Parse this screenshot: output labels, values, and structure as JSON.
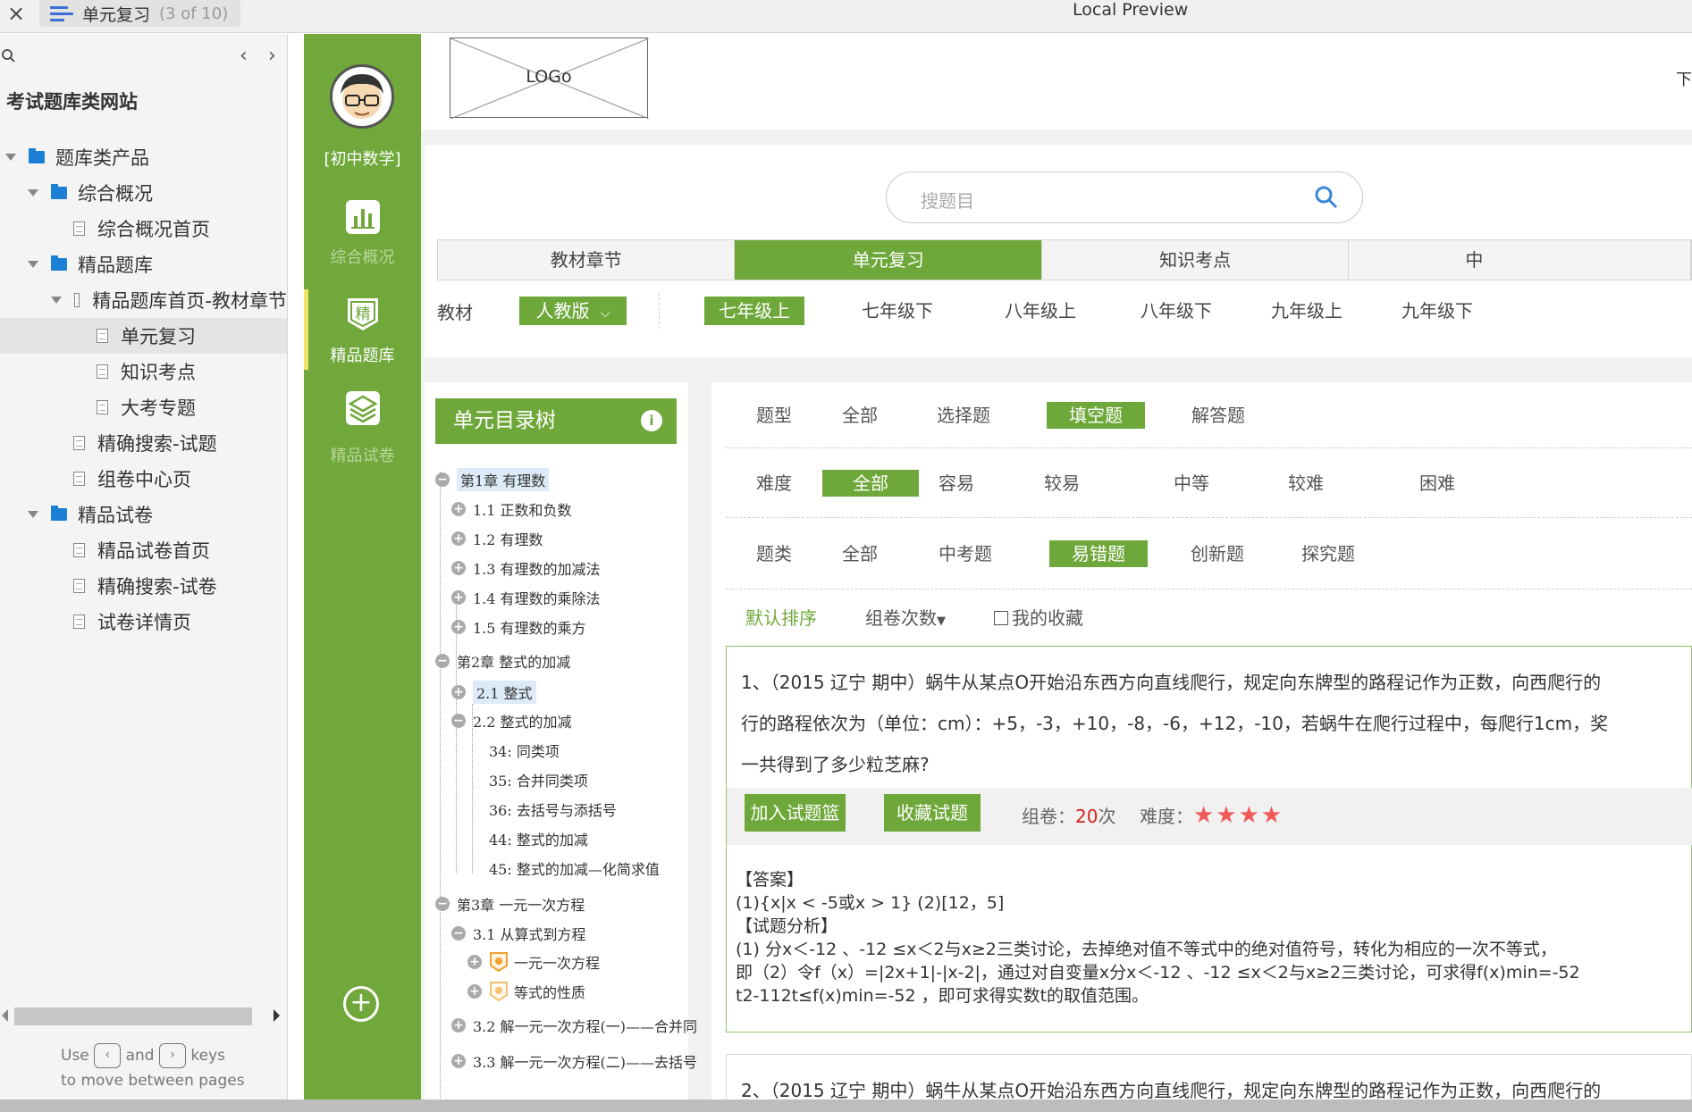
{
  "window": {
    "doc_title": "单元复习",
    "doc_count": "(3 of 10)",
    "title": "Local Preview",
    "close_glyph": "×"
  },
  "sitemap": {
    "project": "考试题库类网站",
    "nav_prev": "‹",
    "nav_next": "›",
    "items": [
      {
        "label": "题库类产品",
        "type": "folder",
        "level": 0
      },
      {
        "label": "综合概况",
        "type": "folder",
        "level": 1
      },
      {
        "label": "综合概况首页",
        "type": "page",
        "level": 2
      },
      {
        "label": "精品题库",
        "type": "folder",
        "level": 1
      },
      {
        "label": "精品题库首页-教材章节",
        "type": "page",
        "level": 2
      },
      {
        "label": "单元复习",
        "type": "page",
        "level": 3,
        "selected": true
      },
      {
        "label": "知识考点",
        "type": "page",
        "level": 3
      },
      {
        "label": "大考专题",
        "type": "page",
        "level": 3
      },
      {
        "label": "精确搜索-试题",
        "type": "page",
        "level": 2
      },
      {
        "label": "组卷中心页",
        "type": "page",
        "level": 2
      },
      {
        "label": "精品试卷",
        "type": "folder",
        "level": 1
      },
      {
        "label": "精品试卷首页",
        "type": "page",
        "level": 2
      },
      {
        "label": "精确搜索-试卷",
        "type": "page",
        "level": 2
      },
      {
        "label": "试卷详情页",
        "type": "page",
        "level": 2
      }
    ],
    "hint_use": "Use",
    "hint_and": "and",
    "hint_keys": "keys",
    "hint_line2": "to move between pages",
    "key_prev": "‹",
    "key_next": "›"
  },
  "leftnav": {
    "subject": "[初中数学]",
    "items": [
      {
        "label": "综合概况",
        "icon": "bar-chart-icon",
        "active": false
      },
      {
        "label": "精品题库",
        "icon": "jing-badge-icon",
        "active": true
      },
      {
        "label": "精品试卷",
        "icon": "layers-icon",
        "active": false
      }
    ],
    "add_glyph": "+"
  },
  "header": {
    "logo": "LOGo",
    "right_text": "下"
  },
  "search": {
    "placeholder": "搜题目"
  },
  "tabs": [
    "教材章节",
    "单元复习",
    "知识考点",
    "中"
  ],
  "active_tab": 1,
  "filter": {
    "label": "教材",
    "edition": "人教版",
    "grades": [
      "七年级上",
      "七年级下",
      "八年级上",
      "八年级下",
      "九年级上",
      "九年级下"
    ],
    "active_grade": 0
  },
  "tree": {
    "title": "单元目录树",
    "info_glyph": "i",
    "nodes": [
      {
        "label": "第1章 有理数",
        "btn": "−",
        "hl": true
      },
      {
        "label": "1.1 正数和负数",
        "btn": "+"
      },
      {
        "label": "1.2 有理数",
        "btn": "+"
      },
      {
        "label": "1.3 有理数的加减法",
        "btn": "+"
      },
      {
        "label": "1.4 有理数的乘除法",
        "btn": "+"
      },
      {
        "label": "1.5 有理数的乘方",
        "btn": "+"
      },
      {
        "label": "第2章 整式的加减",
        "btn": "−"
      },
      {
        "label": "2.1 整式",
        "btn": "+",
        "hl": true
      },
      {
        "label": "2.2 整式的加减",
        "btn": "−"
      },
      {
        "label": "34:  同类项",
        "btn": ""
      },
      {
        "label": "35:  合并同类项",
        "btn": ""
      },
      {
        "label": "36:  去括号与添括号",
        "btn": ""
      },
      {
        "label": "44:  整式的加减",
        "btn": ""
      },
      {
        "label": "45:  整式的加减—化简求值",
        "btn": ""
      },
      {
        "label": "第3章 一元一次方程",
        "btn": "−"
      },
      {
        "label": "3.1 从算式到方程",
        "btn": "−"
      },
      {
        "label": "一元一次方程",
        "btn": "+"
      },
      {
        "label": "等式的性质",
        "btn": "+"
      },
      {
        "label": "3.2 解一元一次方程(一)——合并同",
        "btn": "+"
      },
      {
        "label": "3.3 解一元一次方程(二)——去括号",
        "btn": "+"
      }
    ]
  },
  "filters": {
    "type_label": "题型",
    "types": [
      "全部",
      "选择题",
      "填空题",
      "解答题"
    ],
    "type_active": 2,
    "diff_label": "难度",
    "diffs": [
      "全部",
      "容易",
      "较易",
      "中等",
      "较难",
      "困难"
    ],
    "diff_active": 0,
    "cat_label": "题类",
    "cats": [
      "全部",
      "中考题",
      "易错题",
      "创新题",
      "探究题"
    ],
    "cat_active": 2,
    "sort_default": "默认排序",
    "sort_count": "组卷次数",
    "sort_count_arrow": "▼",
    "favorite": "我的收藏"
  },
  "question": {
    "line1": "1、（2015 辽宁 期中）蜗牛从某点O开始沿东西方向直线爬行，规定向东牌型的路程记作为正数，向西爬行的",
    "line2": "行的路程依次为（单位：cm）：+5，-3，+10，-8，-6，+12，-10，若蜗牛在爬行过程中，每爬行1cm，奖",
    "line3": "一共得到了多少粒芝麻?",
    "add_btn": "加入试题篮",
    "fav_btn": "收藏试题",
    "count_label": "组卷：",
    "count_value": "20",
    "count_unit": "次",
    "diff_label": "难度：",
    "stars": "★★★★",
    "answer_title": "【答案】",
    "answer": "(1){x|x < -5或x > 1} (2)[12，5]",
    "analysis_title": "【试题分析】",
    "analysis1": "(1) 分x＜-12 、-12 ≤x＜2与x≥2三类讨论，去掉绝对值不等式中的绝对值符号，转化为相应的一次不等式，",
    "analysis2": "即（2）令f（x）=|2x+1|-|x-2|，通过对自变量x分x＜-12 、-12 ≤x＜2与x≥2三类讨论，可求得f(x)min=-52",
    "analysis3": "t2-112t≤f(x)min=-52 ，即可求得实数t的取值范围。",
    "next_line": "2、（2015 辽宁 期中）蜗牛从某点O开始沿东西方向直线爬行，规定向东牌型的路程记作为正数，向西爬行的"
  },
  "colors": {
    "green": "#6fa83a",
    "accent_red": "#d62020",
    "star": "#f25a5a",
    "folder_blue": "#1b7fd6"
  }
}
